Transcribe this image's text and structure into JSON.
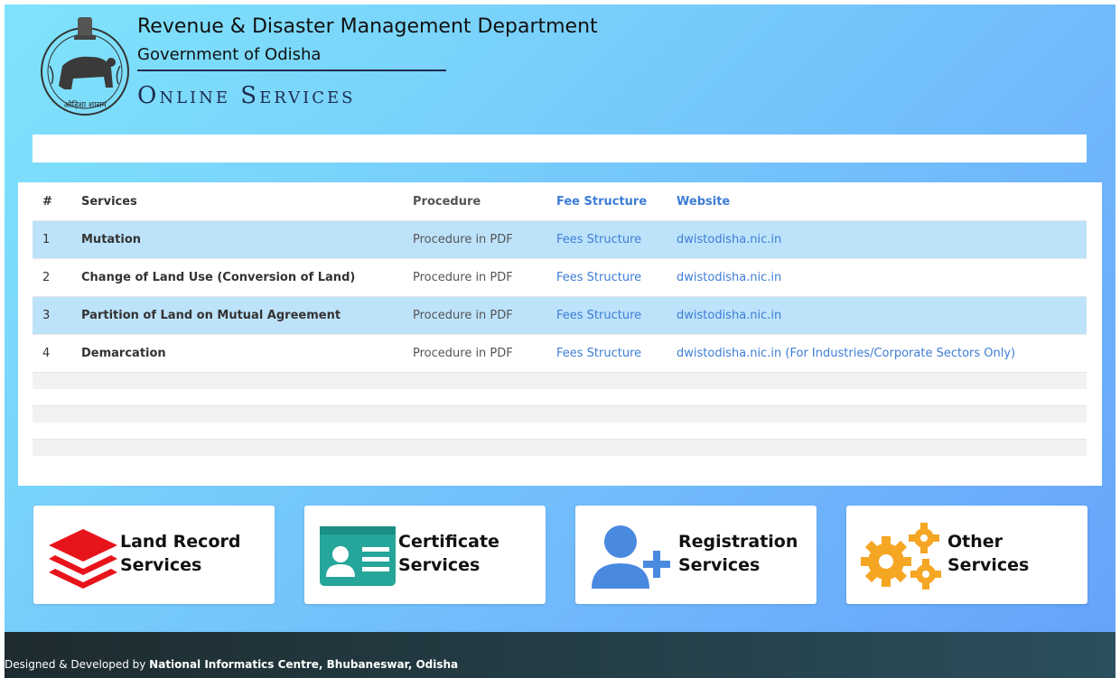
{
  "header": {
    "department": "Revenue & Disaster Management Department",
    "government": "Government of Odisha",
    "tagline": "Online Services",
    "emblem_text": "ओड़िशा शासन"
  },
  "table": {
    "columns": [
      "#",
      "Services",
      "Procedure",
      "Fee Structure",
      "Website"
    ],
    "rows": [
      {
        "num": "1",
        "service": "Mutation",
        "procedure": "Procedure in PDF",
        "fee": "Fees Structure",
        "website": "dwistodisha.nic.in"
      },
      {
        "num": "2",
        "service": "Change of Land Use (Conversion of Land)",
        "procedure": "Procedure in PDF",
        "fee": "Fees Structure",
        "website": "dwistodisha.nic.in"
      },
      {
        "num": "3",
        "service": "Partition of Land on Mutual Agreement",
        "procedure": "Procedure in PDF",
        "fee": "Fees Structure",
        "website": "dwistodisha.nic.in"
      },
      {
        "num": "4",
        "service": "Demarcation",
        "procedure": "Procedure in PDF",
        "fee": "Fees Structure",
        "website": "dwistodisha.nic.in (For Industries/Corporate Sectors Only)"
      }
    ]
  },
  "cards": [
    {
      "line1": "Land Record",
      "line2": "Services",
      "icon": "layers-icon",
      "color": "#e8141c"
    },
    {
      "line1": "Certificate",
      "line2": "Services",
      "icon": "id-card-icon",
      "color": "#26a69a"
    },
    {
      "line1": "Registration",
      "line2": "Services",
      "icon": "user-plus-icon",
      "color": "#4a89e0"
    },
    {
      "line1": "Other",
      "line2": "Services",
      "icon": "gears-icon",
      "color": "#f5a623"
    }
  ],
  "footer": {
    "prefix": "Designed & Developed by ",
    "org": "National Informatics Centre, Bhubaneswar, Odisha"
  },
  "colors": {
    "highlight_row": "#bde3fb",
    "link": "#3d7dd6",
    "title_dark": "#1e2b4f"
  }
}
